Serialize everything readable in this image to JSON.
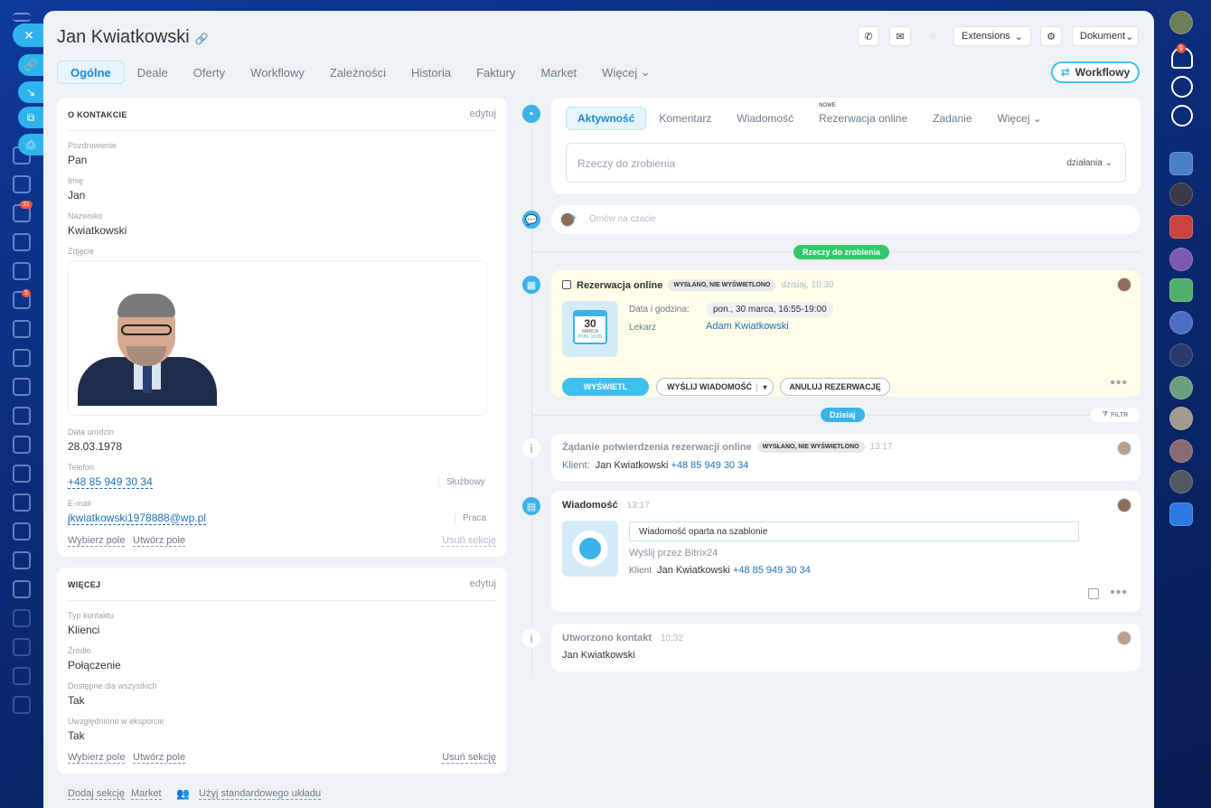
{
  "header": {
    "title": "Jan Kwiatkowski",
    "extensions_label": "Extensions",
    "dokument_label": "Dokument"
  },
  "tabs": [
    {
      "label": "Ogólne"
    },
    {
      "label": "Deale"
    },
    {
      "label": "Oferty"
    },
    {
      "label": "Workflowy"
    },
    {
      "label": "Zależności"
    },
    {
      "label": "Historia"
    },
    {
      "label": "Faktury"
    },
    {
      "label": "Market"
    },
    {
      "label": "Więcej"
    }
  ],
  "workflow_button": "Workflowy",
  "contact_section": {
    "title": "O KONTAKCIE",
    "edit": "edytuj",
    "fields": [
      {
        "label": "Pozdrowienie",
        "value": "Pan"
      },
      {
        "label": "Imię",
        "value": "Jan"
      },
      {
        "label": "Nazwisko",
        "value": "Kwiatkowski"
      },
      {
        "label": "Zdjęcie",
        "value": ""
      },
      {
        "label": "Data urodzin",
        "value": "28.03.1978"
      },
      {
        "label": "Telefon",
        "value": "+48 85 949 30 34",
        "type": "Służbowy"
      },
      {
        "label": "E-mail",
        "value": "jkwiatkowski1978888@wp.pl",
        "type": "Praca"
      }
    ],
    "choose_field": "Wybierz pole",
    "create_field": "Utwórz pole",
    "delete_section": "Usuń sekcję"
  },
  "more_section": {
    "title": "WIĘCEJ",
    "edit": "edytuj",
    "fields": [
      {
        "label": "Typ kontaktu",
        "value": "Klienci"
      },
      {
        "label": "Źródło",
        "value": "Połączenie"
      },
      {
        "label": "Dostępne dla wszystkich",
        "value": "Tak"
      },
      {
        "label": "Uwzględniono w eksporcie",
        "value": "Tak"
      }
    ],
    "choose_field": "Wybierz pole",
    "create_field": "Utwórz pole",
    "delete_section": "Usuń sekcję"
  },
  "footer_links": {
    "add_section": "Dodaj sekcję",
    "market": "Market",
    "standard_layout": "Użyj standardowego układu"
  },
  "activity": {
    "tabs": [
      "Aktywność",
      "Komentarz",
      "Wiadomość",
      "Rezerwacja online",
      "Zadanie",
      "Więcej"
    ],
    "new_badge": "NOWE",
    "todo_placeholder": "Rzeczy do zrobienia",
    "actions_label": "działania",
    "chat_placeholder": "Omów na czacie"
  },
  "todo_pill": "Rzeczy do zrobienia",
  "booking": {
    "title": "Rezerwacja online",
    "status": "WYSŁANO, NIE WYŚWIETLONO",
    "time": "dzisiaj, 10:30",
    "cal_day": "30",
    "cal_month": "MARCA",
    "cal_sub": "PON. 16:55",
    "date_label": "Data i godzina:",
    "date_value": "pon., 30 marca, 16:55-19:00",
    "doctor_label": "Lekarz",
    "doctor_value": "Adam Kwiatkowski",
    "btn_view": "WYŚWIETL",
    "btn_send": "WYŚLIJ WIADOMOŚĆ",
    "btn_cancel": "ANULUJ REZERWACJĘ"
  },
  "today_pill": "Dzisiaj",
  "filter_label": "FILTR",
  "confirm": {
    "title": "Żądanie potwierdzenia rezerwacji online",
    "status": "WYSŁANO, NIE WYŚWIETLONO",
    "time": "13:17",
    "client_label": "Klient:",
    "client_name": "Jan Kwiatkowski",
    "client_phone": "+48 85 949 30 34"
  },
  "message": {
    "title": "Wiadomość",
    "time": "13:17",
    "bubble": "Wiadomość oparta na szablonie",
    "sent_via": "Wyślij przez Bitrix24",
    "client_label": "Klient",
    "client_name": "Jan Kwiatkowski",
    "client_phone": "+48 85 949 30 34"
  },
  "created": {
    "title": "Utworzono kontakt",
    "time": "10:32",
    "name": "Jan Kwiatkowski"
  },
  "notifications_count": "9",
  "left_badge_1": "31",
  "left_badge_2": "5"
}
